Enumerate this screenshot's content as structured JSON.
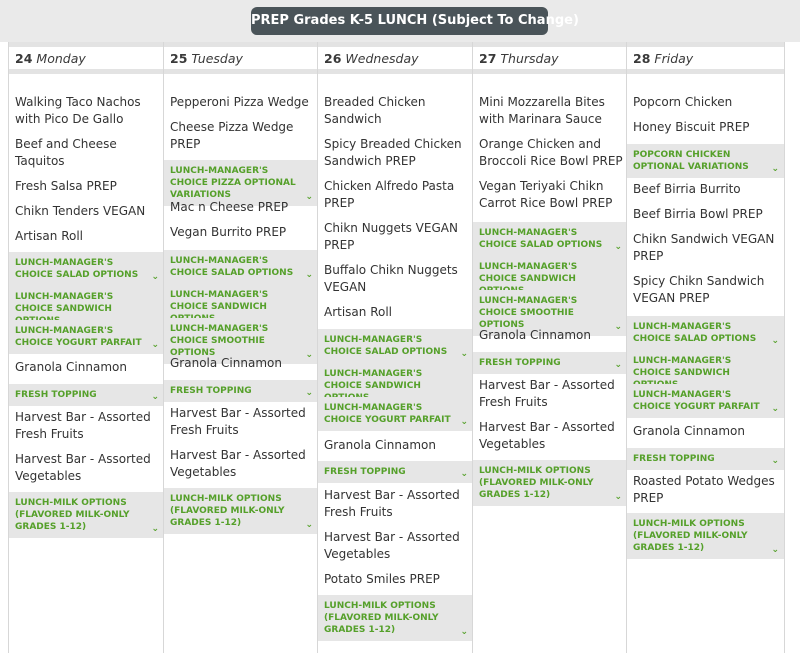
{
  "title": "PREP Grades K-5 LUNCH (Subject To Change)",
  "days": [
    {
      "num": "24",
      "day": "Monday"
    },
    {
      "num": "25",
      "day": "Tuesday"
    },
    {
      "num": "26",
      "day": "Wednesday"
    },
    {
      "num": "27",
      "day": "Thursday"
    },
    {
      "num": "28",
      "day": "Friday"
    }
  ],
  "monday": {
    "i1": "Walking Taco Nachos with Pico De Gallo",
    "i2": "Beef and Cheese Taquitos",
    "i3": "Fresh Salsa PREP",
    "i4": "Chikn Tenders VEGAN",
    "i5": "Artisan Roll",
    "o1": "LUNCH-MANAGER'S CHOICE SALAD OPTIONS",
    "o2": "LUNCH-MANAGER'S CHOICE SANDWICH OPTIONS",
    "o3": "LUNCH-MANAGER'S CHOICE YOGURT PARFAIT",
    "i6": "Granola Cinnamon",
    "o4": "FRESH TOPPING",
    "i7": "Harvest Bar - Assorted Fresh Fruits",
    "i8": "Harvest Bar - Assorted Vegetables",
    "o5": "LUNCH-MILK OPTIONS (FLAVORED MILK-ONLY GRADES 1-12)"
  },
  "tuesday": {
    "i1": "Pepperoni Pizza Wedge",
    "i2": "Cheese Pizza Wedge PREP",
    "o1": "LUNCH-MANAGER'S CHOICE PIZZA OPTIONAL VARIATIONS",
    "i3": "Mac n Cheese PREP",
    "i4": "Vegan Burrito PREP",
    "o2": "LUNCH-MANAGER'S CHOICE SALAD OPTIONS",
    "o3": "LUNCH-MANAGER'S CHOICE SANDWICH OPTIONS",
    "o4": "LUNCH-MANAGER'S CHOICE SMOOTHIE OPTIONS",
    "i5": "Granola Cinnamon",
    "o5": "FRESH TOPPING",
    "i6": "Harvest Bar - Assorted Fresh Fruits",
    "i7": "Harvest Bar - Assorted Vegetables",
    "o6": "LUNCH-MILK OPTIONS (FLAVORED MILK-ONLY GRADES 1-12)"
  },
  "wednesday": {
    "i1": "Breaded Chicken Sandwich",
    "i2": "Spicy Breaded Chicken Sandwich PREP",
    "i3": "Chicken Alfredo Pasta PREP",
    "i4": "Chikn Nuggets VEGAN PREP",
    "i5": "Buffalo Chikn Nuggets VEGAN",
    "i6": "Artisan Roll",
    "o1": "LUNCH-MANAGER'S CHOICE SALAD OPTIONS",
    "o2": "LUNCH-MANAGER'S CHOICE SANDWICH OPTIONS",
    "o3": "LUNCH-MANAGER'S CHOICE YOGURT PARFAIT",
    "i7": "Granola Cinnamon",
    "o4": "FRESH TOPPING",
    "i8": "Harvest Bar - Assorted Fresh Fruits",
    "i9": "Harvest Bar - Assorted Vegetables",
    "i10": "Potato Smiles PREP",
    "o5": "LUNCH-MILK OPTIONS (FLAVORED MILK-ONLY GRADES 1-12)"
  },
  "thursday": {
    "i1": "Mini Mozzarella Bites with Marinara Sauce",
    "i2": "Orange Chicken and Broccoli Rice Bowl PREP",
    "i3": "Vegan Teriyaki Chikn Carrot Rice Bowl PREP",
    "o1": "LUNCH-MANAGER'S CHOICE SALAD OPTIONS",
    "o2": "LUNCH-MANAGER'S CHOICE SANDWICH OPTIONS",
    "o3": "LUNCH-MANAGER'S CHOICE SMOOTHIE OPTIONS",
    "i4": "Granola Cinnamon",
    "o4": "FRESH TOPPING",
    "i5": "Harvest Bar - Assorted Fresh Fruits",
    "i6": "Harvest Bar - Assorted Vegetables",
    "o5": "LUNCH-MILK OPTIONS (FLAVORED MILK-ONLY GRADES 1-12)"
  },
  "friday": {
    "i1": "Popcorn Chicken",
    "i2": "Honey Biscuit PREP",
    "o1": "POPCORN CHICKEN OPTIONAL VARIATIONS",
    "i3": "Beef Birria Burrito",
    "i4": "Beef Birria Bowl PREP",
    "i5": "Chikn Sandwich VEGAN PREP",
    "i6": "Spicy Chikn Sandwich VEGAN PREP",
    "o2": "LUNCH-MANAGER'S CHOICE SALAD OPTIONS",
    "o3": "LUNCH-MANAGER'S CHOICE SANDWICH OPTIONS",
    "o4": "LUNCH-MANAGER'S CHOICE YOGURT PARFAIT",
    "i7": "Granola Cinnamon",
    "o5": "FRESH TOPPING",
    "i8": "Roasted Potato Wedges PREP",
    "o6": "LUNCH-MILK OPTIONS (FLAVORED MILK-ONLY GRADES 1-12)"
  },
  "chevron_icon": "chevron-down-icon",
  "colors": {
    "accent": "#55a02a",
    "title_bg": "#4a5459",
    "option_bg": "#e6e6e6"
  }
}
